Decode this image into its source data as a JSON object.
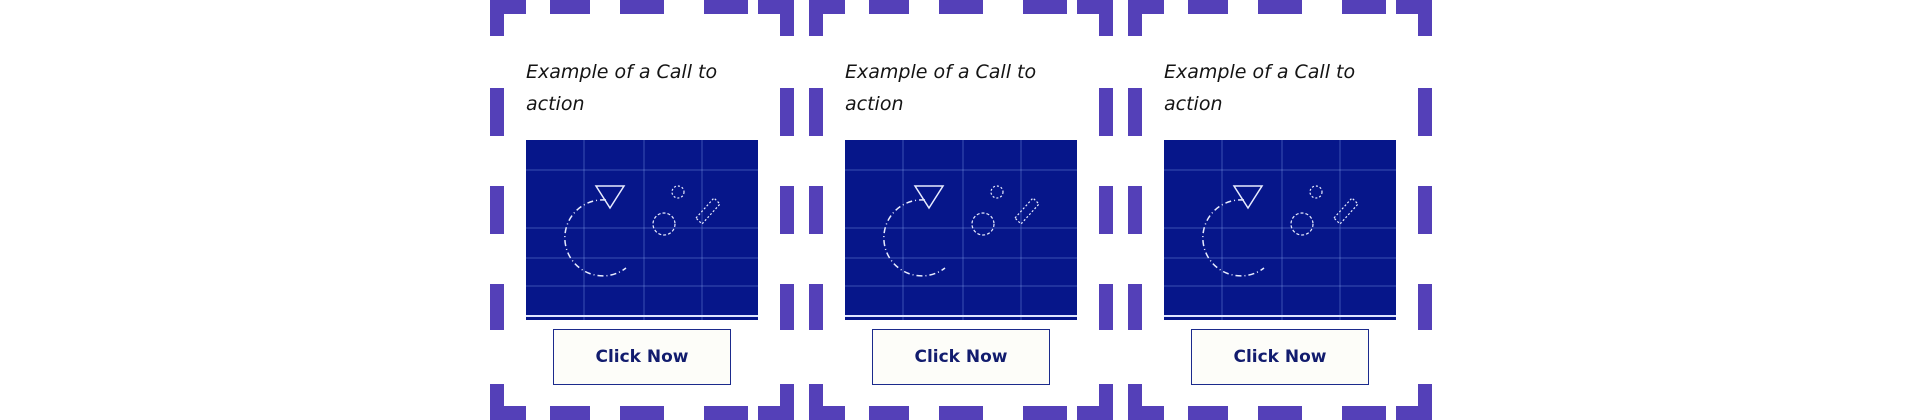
{
  "colors": {
    "frame": "#5440b8",
    "image_bg": "#06168a",
    "button_text": "#121c6e",
    "button_border": "#1b2a8c",
    "title_text": "#141414"
  },
  "cards": [
    {
      "title": "Example of a Call to action",
      "button_label": "Click Now",
      "image_icon": "blueprint-illustration-icon"
    },
    {
      "title": "Example of a Call to action",
      "button_label": "Click Now",
      "image_icon": "blueprint-illustration-icon"
    },
    {
      "title": "Example of a Call to action",
      "button_label": "Click Now",
      "image_icon": "blueprint-illustration-icon"
    }
  ]
}
